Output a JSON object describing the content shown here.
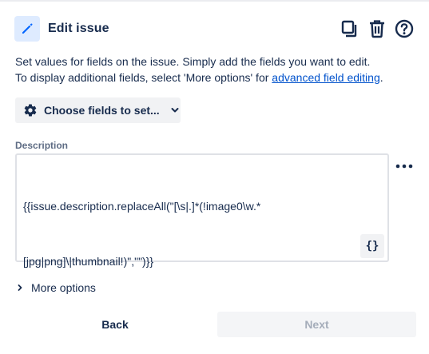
{
  "header": {
    "title": "Edit issue",
    "icon": "pencil-icon",
    "actions": [
      "copy-icon",
      "trash-icon",
      "help-icon"
    ]
  },
  "intro": {
    "line1": "Set values for fields on the issue. Simply add the fields you want to edit.",
    "line2_prefix": "To display additional fields, select 'More options' for ",
    "link_text": "advanced field editing",
    "line2_suffix": "."
  },
  "choose_fields": {
    "label": "Choose fields to set...",
    "icon": "gear-icon",
    "chevron": "chevron-down-icon"
  },
  "description_field": {
    "label": "Description",
    "value_line1": "{{issue.description.replaceAll(\"[\\s|.]*(!image0\\w.*",
    "value_line2": "[jpg|png]\\|thumbnail!)\",\"\")}}",
    "smart_value_button": "{}",
    "more_menu": "more-icon"
  },
  "more_options": {
    "label": "More options"
  },
  "footer": {
    "back_label": "Back",
    "next_label": "Next"
  },
  "colors": {
    "accent": "#0052cc",
    "icon_bg": "#deebff",
    "pencil": "#0065ff",
    "button_bg": "#f1f2f4",
    "disabled_text": "#a5adba"
  }
}
